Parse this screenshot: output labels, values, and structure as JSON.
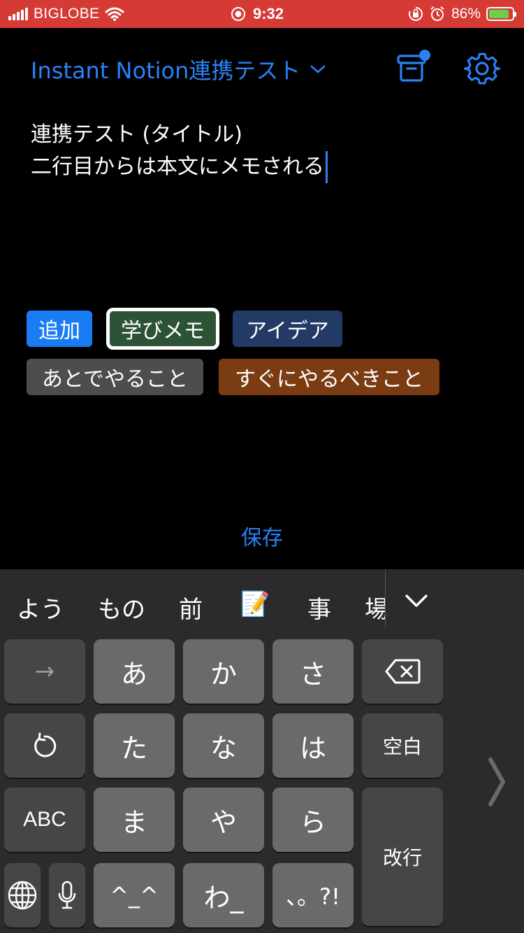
{
  "status_bar": {
    "carrier": "BIGLOBE",
    "time": "9:32",
    "battery_percent": "86%",
    "battery_level": 0.86,
    "background_color": "#d63a34"
  },
  "header": {
    "title": "Instant Notion連携テスト",
    "chevron_icon": "chevron-down-icon",
    "archive_icon": "archive-box-icon",
    "settings_icon": "gear-icon",
    "accent_color": "#2a82f6"
  },
  "editor": {
    "line1": "連携テスト (タイトル)",
    "line2": "二行目からは本文にメモされる"
  },
  "tags": [
    {
      "label": "追加",
      "color": "#1a7cf5"
    },
    {
      "label": "学びメモ",
      "color": "#2c5335",
      "selected": true
    },
    {
      "label": "アイデア",
      "color": "#233a66"
    },
    {
      "label": "あとでやること",
      "color": "#4d4d4f"
    },
    {
      "label": "すぐにやるべきこと",
      "color": "#7b3c14"
    }
  ],
  "save_label": "保存",
  "keyboard": {
    "candidates": [
      "よう",
      "もの",
      "前",
      "📝",
      "事",
      "場"
    ],
    "keys": {
      "arrow": "→",
      "a": "あ",
      "ka": "か",
      "sa": "さ",
      "backspace_icon": "delete-icon",
      "undo_icon": "undo-icon",
      "ta": "た",
      "na": "な",
      "ha": "は",
      "space": "空白",
      "abc": "ABC",
      "ma": "ま",
      "ya": "や",
      "ra": "ら",
      "enter": "改行",
      "globe_icon": "globe-icon",
      "mic_icon": "microphone-icon",
      "kaomoji": "^_^",
      "wa": "わ_",
      "punct": "、。?!"
    }
  }
}
